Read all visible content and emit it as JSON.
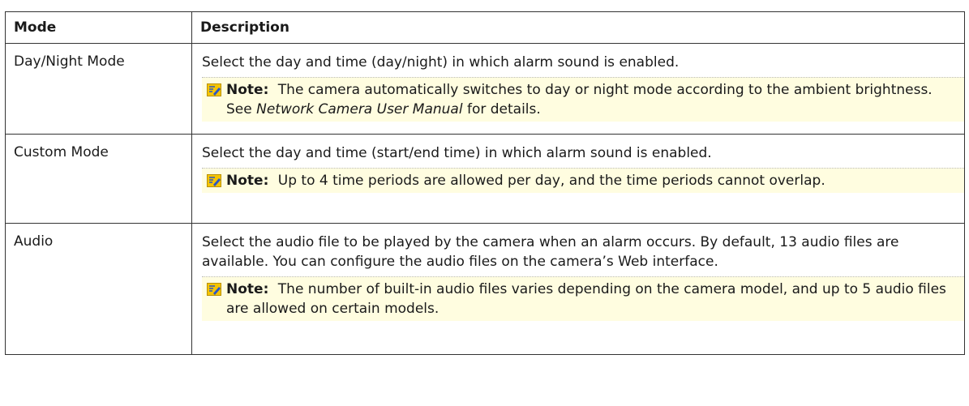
{
  "headers": {
    "mode": "Mode",
    "description": "Description"
  },
  "rows": [
    {
      "mode": "Day/Night Mode",
      "description": "Select the day and time (day/night) in which alarm sound is enabled.",
      "note": {
        "label": "Note:",
        "before": "The camera automatically switches to day or night mode according to the ambient brightness. See ",
        "italic": "Network Camera User Manual",
        "after": " for details."
      }
    },
    {
      "mode": "Custom Mode",
      "description": "Select the day and time (start/end time) in which alarm sound is enabled.",
      "note": {
        "label": "Note:",
        "text": "Up to 4 time periods are allowed per day, and the time periods cannot overlap."
      }
    },
    {
      "mode": "Audio",
      "description": "Select the audio file to be played by the camera when an alarm occurs. By default, 13 audio files are available. You can configure the audio files on the camera’s Web interface.",
      "note": {
        "label": "Note:",
        "text": "The number of built-in audio files varies depending on the camera model, and up to 5 audio files are allowed on certain models."
      }
    }
  ],
  "icons": {
    "note": "note-pencil-icon"
  },
  "colors": {
    "note_bg": "#fffde0",
    "icon_yellow": "#f5c400",
    "icon_blue": "#2a56c8"
  }
}
